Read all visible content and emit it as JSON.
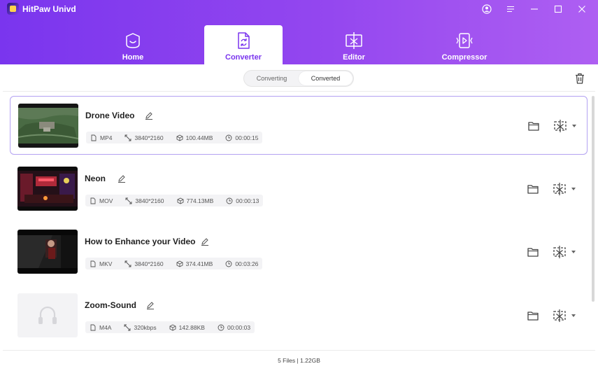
{
  "app": {
    "title": "HitPaw Univd"
  },
  "tabs": [
    {
      "label": "Home",
      "icon": "home-face-icon"
    },
    {
      "label": "Converter",
      "icon": "converter-icon"
    },
    {
      "label": "Editor",
      "icon": "editor-icon"
    },
    {
      "label": "Compressor",
      "icon": "compressor-icon"
    }
  ],
  "segment": {
    "converting": "Converting",
    "converted": "Converted"
  },
  "items": [
    {
      "name": "Drone Video",
      "format": "MP4",
      "resolution": "3840*2160",
      "size": "100.44MB",
      "duration": "00:00:15"
    },
    {
      "name": "Neon",
      "format": "MOV",
      "resolution": "3840*2160",
      "size": "774.13MB",
      "duration": "00:00:13"
    },
    {
      "name": "How to Enhance your Video",
      "format": "MKV",
      "resolution": "3840*2160",
      "size": "374.41MB",
      "duration": "00:03:26"
    },
    {
      "name": "Zoom-Sound",
      "format": "M4A",
      "resolution": "320kbps",
      "size": "142.88KB",
      "duration": "00:00:03"
    }
  ],
  "footer": {
    "summary": "5 Files | 1.22GB"
  },
  "colors": {
    "accent": "#7a35ee",
    "selected_border": "#b3a2f2"
  }
}
